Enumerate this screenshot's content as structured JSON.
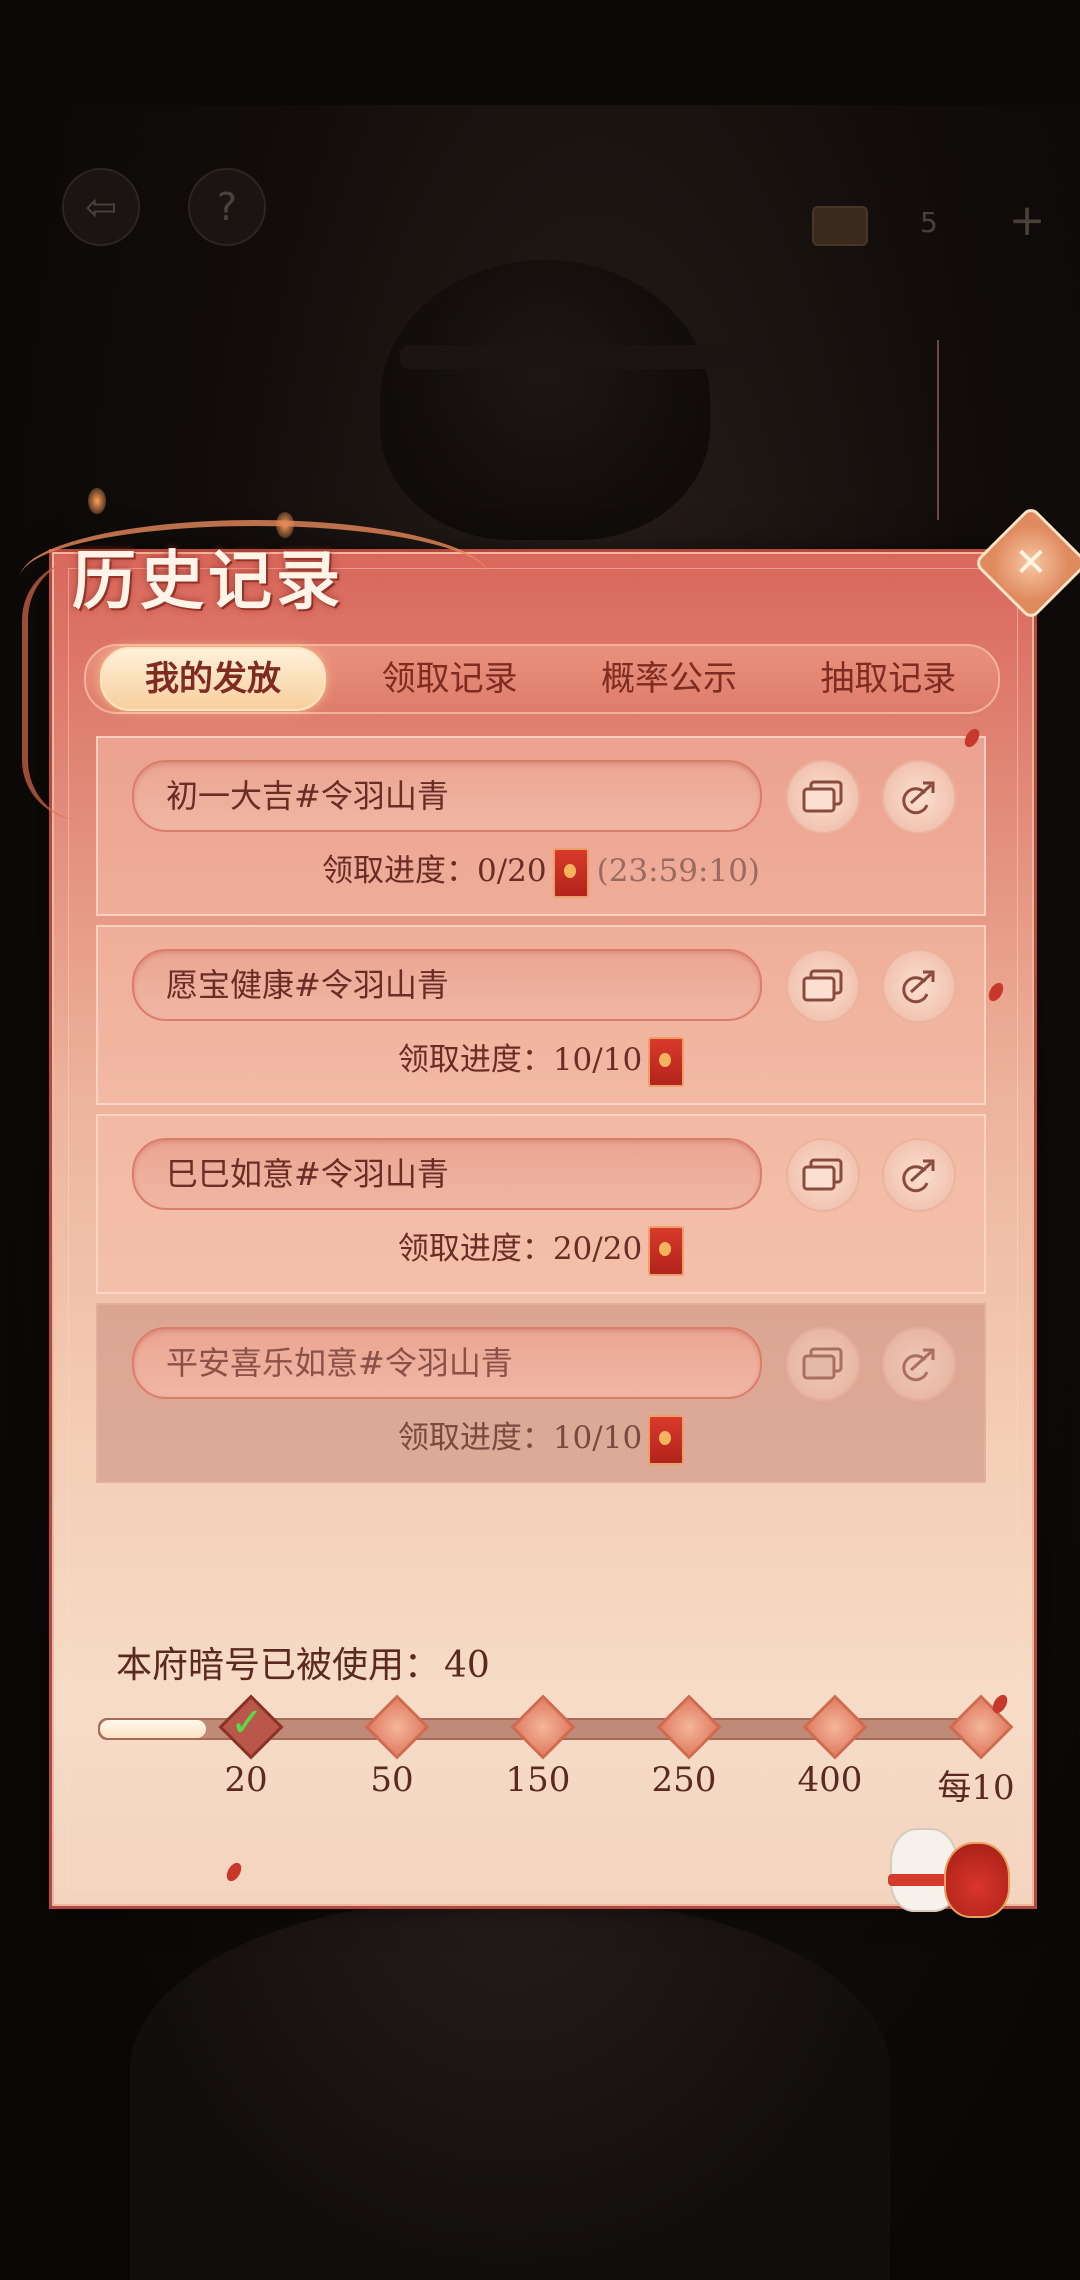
{
  "hud": {
    "back_icon": "back-arrow-icon",
    "help_label": "?",
    "count": "5",
    "plus_label": "+"
  },
  "panel": {
    "title": "历史记录",
    "close_icon": "close-icon",
    "tabs": [
      {
        "label": "我的发放",
        "active": true
      },
      {
        "label": "领取记录",
        "active": false
      },
      {
        "label": "概率公示",
        "active": false
      },
      {
        "label": "抽取记录",
        "active": false
      }
    ],
    "records": [
      {
        "code": "初一大吉#令羽山青",
        "progress_label": "领取进度：",
        "progress": "0/20",
        "timer": "(23:59:10)",
        "dimmed": false
      },
      {
        "code": "愿宝健康#令羽山青",
        "progress_label": "领取进度：",
        "progress": "10/10",
        "timer": "",
        "dimmed": false
      },
      {
        "code": "巳巳如意#令羽山青",
        "progress_label": "领取进度：",
        "progress": "20/20",
        "timer": "",
        "dimmed": false
      },
      {
        "code": "平安喜乐如意#令羽山青",
        "progress_label": "领取进度：",
        "progress": "10/10",
        "timer": "",
        "dimmed": true
      }
    ],
    "usage": {
      "label": "本府暗号已被使用：",
      "value": "40",
      "milestones": [
        "20",
        "50",
        "150",
        "250",
        "400",
        "每10"
      ],
      "reached_fraction": 0.12
    }
  },
  "colors": {
    "accent": "#7e2b22",
    "panel_top": "#d9675c",
    "panel_bottom": "#f6dcc7",
    "check": "#5ad94a"
  }
}
